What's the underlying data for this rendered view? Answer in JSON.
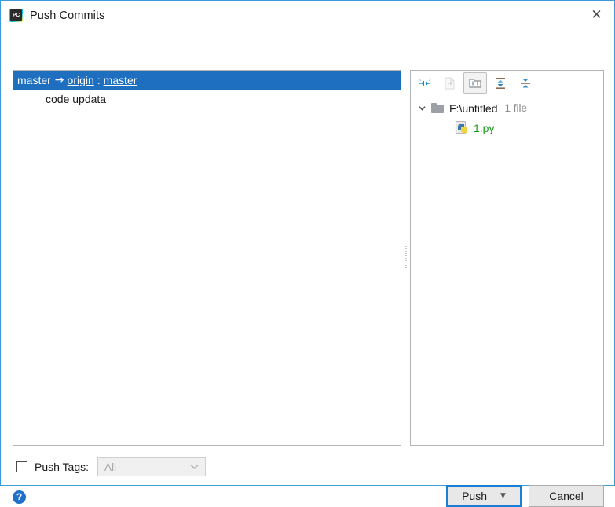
{
  "window": {
    "title": "Push Commits",
    "app_icon": "pycharm-icon",
    "app_icon_text": "PC",
    "close_icon": "✕"
  },
  "commits": {
    "branch_row": {
      "local": "master",
      "arrow": "→",
      "remote_name": "origin",
      "separator": ":",
      "remote_branch": "master"
    },
    "messages": [
      {
        "text": "code updata"
      }
    ]
  },
  "files": {
    "toolbar": [
      {
        "name": "collapse-selection-icon",
        "title": "Collapse",
        "state": "enabled"
      },
      {
        "name": "show-diff-icon",
        "title": "Show Diff",
        "state": "disabled"
      },
      {
        "name": "group-by-directory-icon",
        "title": "Group By Directory",
        "state": "pressed"
      },
      {
        "name": "expand-all-icon",
        "title": "Expand All",
        "state": "enabled"
      },
      {
        "name": "collapse-all-icon",
        "title": "Collapse All",
        "state": "enabled"
      }
    ],
    "tree": {
      "directory": {
        "chevron": "⌄",
        "path": "F:\\untitled",
        "count": "1 file"
      },
      "file": {
        "name": "1.py",
        "icon": "python-file-icon",
        "color": "#1a9b1a"
      }
    }
  },
  "options": {
    "push_tags": {
      "label_pre": "Push ",
      "label_mnemonic": "T",
      "label_post": "ags:",
      "checked": false
    },
    "tags_combo": {
      "value": "All",
      "chevron": "⌄",
      "enabled": false
    }
  },
  "footer": {
    "help_label": "?",
    "push": {
      "label_mnemonic": "P",
      "label_rest": "ush",
      "split_arrow": "▼"
    },
    "cancel": {
      "label": "Cancel"
    }
  },
  "colors": {
    "selection": "#1e6fbf",
    "accent_border": "#3a9bd9",
    "file_green": "#1a9b1a",
    "muted": "#8c8c8c"
  }
}
